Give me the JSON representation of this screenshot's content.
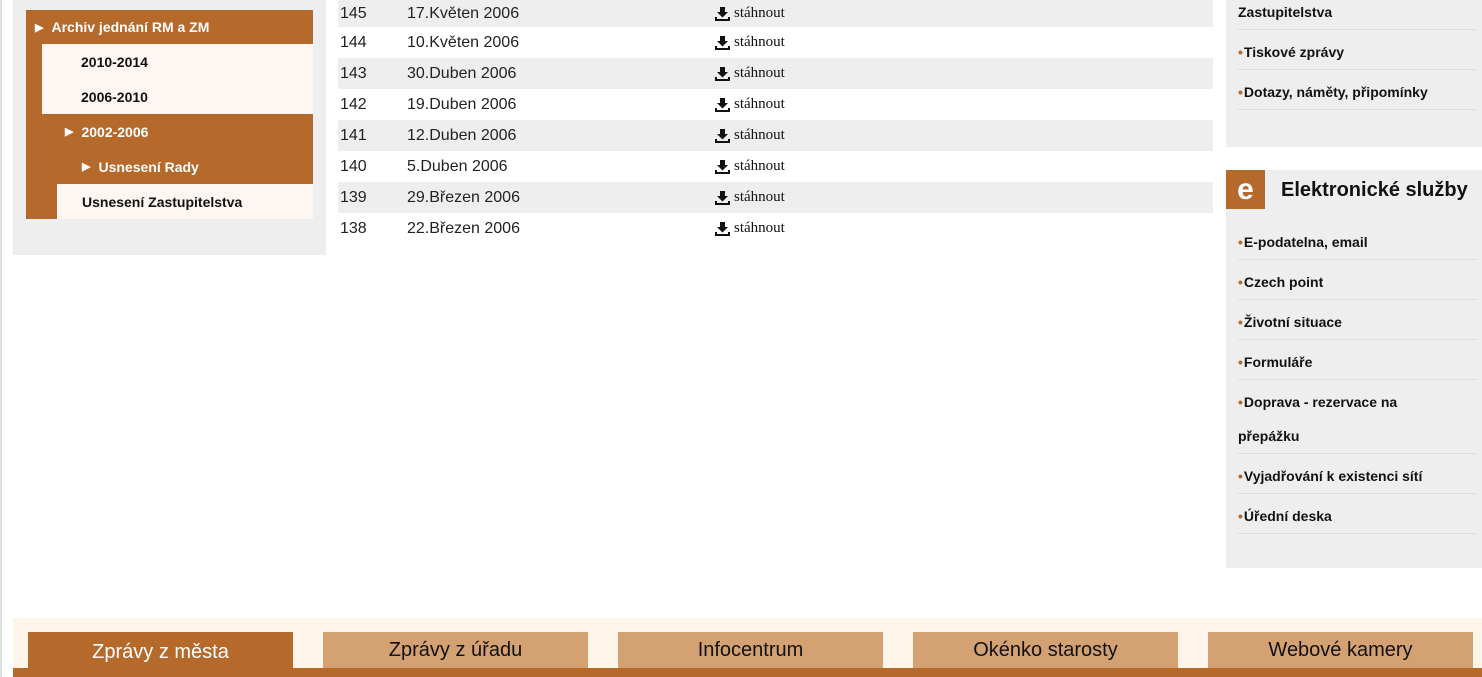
{
  "left_nav": {
    "root": "Archiv jednání RM a ZM",
    "years": [
      "2010-2014",
      "2006-2010"
    ],
    "active_year": "2002-2006",
    "sub_active": "Usnesení Rady",
    "sub_other": "Usnesení Zastupitelstva"
  },
  "table": {
    "download_label": "stáhnout",
    "rows": [
      {
        "num": "145",
        "date": "17.Květen 2006"
      },
      {
        "num": "144",
        "date": "10.Květen 2006"
      },
      {
        "num": "143",
        "date": "30.Duben 2006"
      },
      {
        "num": "142",
        "date": "19.Duben 2006"
      },
      {
        "num": "141",
        "date": "12.Duben 2006"
      },
      {
        "num": "140",
        "date": "5.Duben 2006"
      },
      {
        "num": "139",
        "date": "29.Březen 2006"
      },
      {
        "num": "138",
        "date": "22.Březen 2006"
      }
    ]
  },
  "right_top": {
    "links": [
      "Zastupitelstva",
      "Tiskové zprávy",
      "Dotazy, náměty, připomínky"
    ]
  },
  "eservices": {
    "logo_letter": "e",
    "title": "Elektronické služby",
    "links": [
      "E-podatelna, email",
      "Czech point",
      "Životní situace",
      "Formuláře",
      "Doprava - rezervace na",
      "přepážku",
      "Vyjadřování k existenci sítí",
      "Úřední deska"
    ]
  },
  "tabs": [
    "Zprávy z města",
    "Zprávy z úřadu",
    "Infocentrum",
    "Okénko starosty",
    "Webové kamery"
  ],
  "colors": {
    "accent": "#b5692a",
    "tab": "#d4a173",
    "panel": "#eeeeee"
  }
}
